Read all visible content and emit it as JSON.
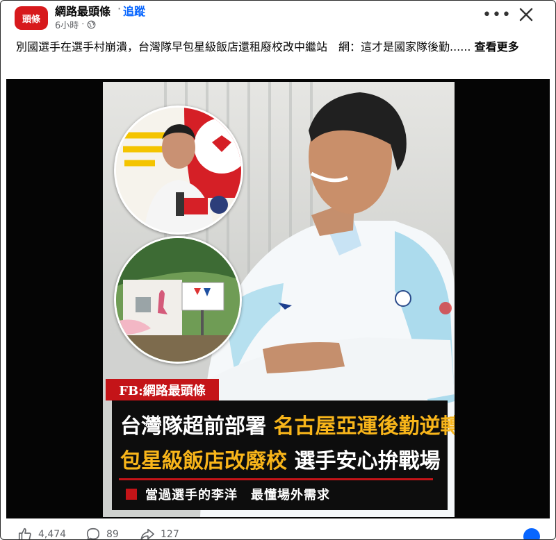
{
  "header": {
    "avatar_text": "頭條",
    "page_name": "網路最頭條",
    "separator": "·",
    "follow_label": "追蹤",
    "time": "6小時",
    "more_icon": "more-horizontal-icon",
    "close_icon": "close-icon"
  },
  "caption": {
    "text": "別國選手在選手村崩潰，台灣隊早包星級飯店還租廢校改中繼站　網：這才是國家隊後勤......",
    "see_more_label": "查看更多"
  },
  "poster": {
    "tag": "FB:網路最頭條",
    "line1_white": "台灣隊超前部署",
    "line1_yellow": "名古屋亞運後勤逆轉",
    "line2_yellow": "包星級飯店改廢校",
    "line2_white": "選手安心拚戰場",
    "line3": "當過選手的李洋　最懂場外需求",
    "colors": {
      "red": "#c41418",
      "yellow": "#f8b51a"
    }
  },
  "footer": {
    "likes": "4,474",
    "comments": "89",
    "shares": "127"
  }
}
